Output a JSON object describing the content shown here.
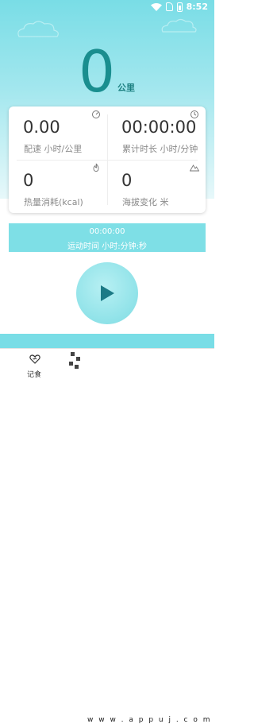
{
  "status_bar": {
    "time": "8:52"
  },
  "distance": {
    "value": "0",
    "unit": "公里"
  },
  "stats": [
    {
      "value": "0.00",
      "label": "配速 小时/公里",
      "icon": "speedometer-icon"
    },
    {
      "value": "00:00:00",
      "label": "累计时长 小时/分钟",
      "icon": "clock-icon"
    },
    {
      "value": "0",
      "label": "热量消耗(kcal)",
      "icon": "flame-icon"
    },
    {
      "value": "0",
      "label": "海拔变化 米",
      "icon": "mountain-icon"
    }
  ],
  "timer": {
    "time": "00:00:00",
    "label": "运动时间 小时:分钟:秒"
  },
  "bottom_nav": {
    "items": [
      {
        "label": "记食",
        "icon": "heart-icon"
      }
    ]
  },
  "watermark": "w w w . a p p u j . c o m",
  "colors": {
    "accent": "#79dde6",
    "primary_text": "#1a8e8f",
    "play_icon": "#1c7a86"
  }
}
